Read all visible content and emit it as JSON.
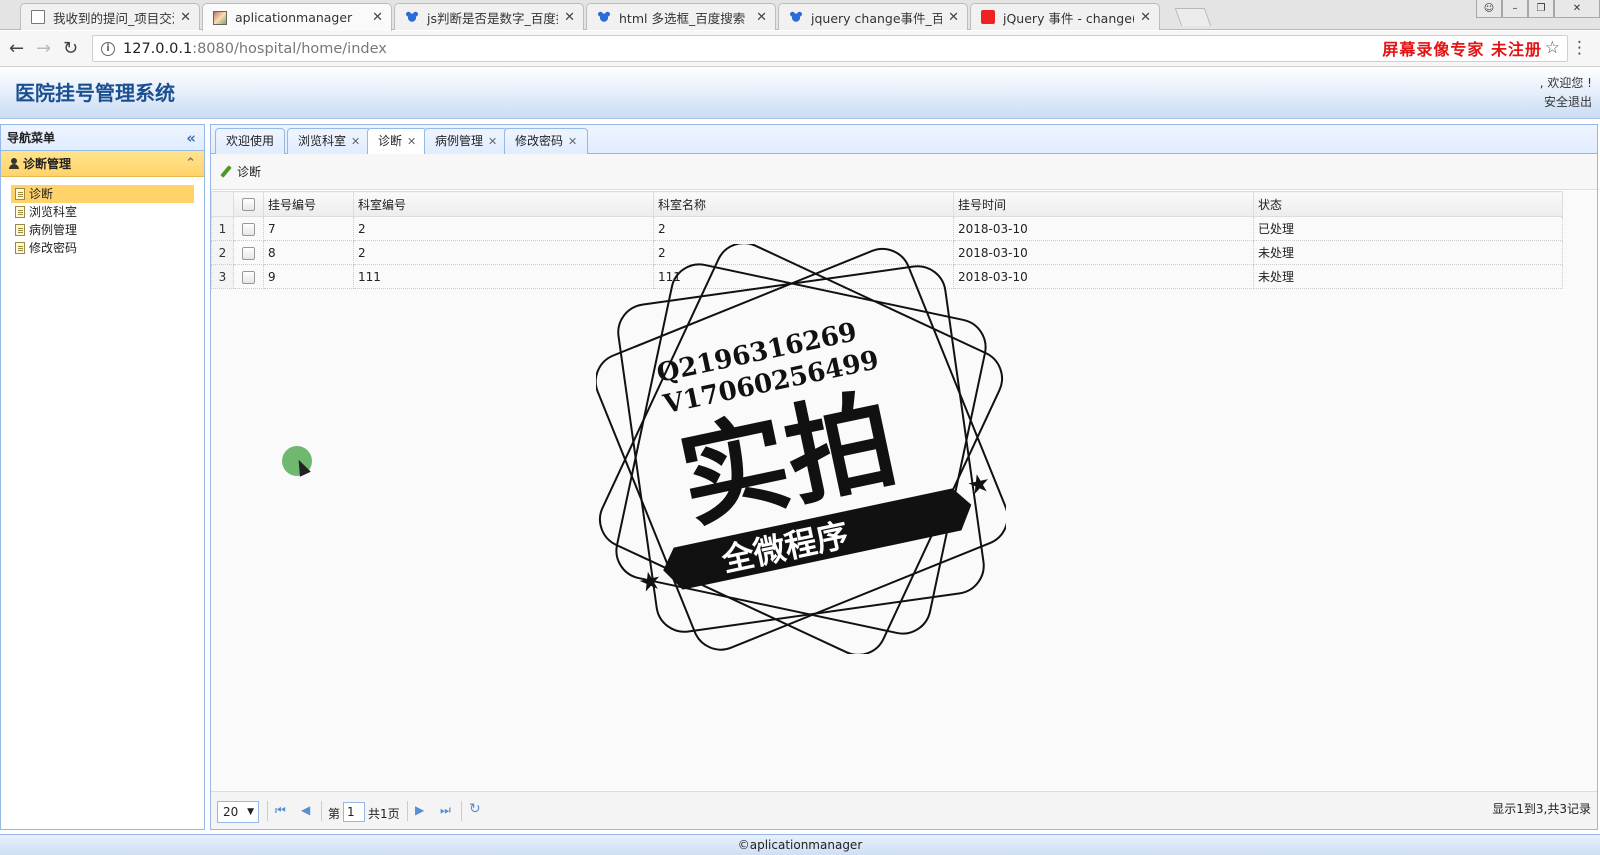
{
  "browser": {
    "tabs": [
      {
        "title": "我收到的提问_项目交流",
        "icon": "document-icon"
      },
      {
        "title": "aplicationmanager",
        "icon": "app-icon"
      },
      {
        "title": "js判断是否是数字_百度搜",
        "icon": "baidu-icon"
      },
      {
        "title": "html 多选框_百度搜索",
        "icon": "baidu-icon"
      },
      {
        "title": "jquery change事件_百度",
        "icon": "baidu-icon"
      },
      {
        "title": "jQuery 事件 - change()",
        "icon": "w3school-icon"
      }
    ],
    "url_host": "127.0.0.1",
    "url_path": ":8080/hospital/home/index",
    "recorder_watermark": "屏幕录像专家 未注册"
  },
  "header": {
    "title": "医院挂号管理系统",
    "welcome": ", 欢迎您 !",
    "logout": "安全退出"
  },
  "sidebar": {
    "title": "导航菜单",
    "group": "诊断管理",
    "items": [
      {
        "label": "诊断",
        "selected": true
      },
      {
        "label": "浏览科室",
        "selected": false
      },
      {
        "label": "病例管理",
        "selected": false
      },
      {
        "label": "修改密码",
        "selected": false
      }
    ]
  },
  "main": {
    "tabs": [
      {
        "label": "欢迎使用",
        "closable": false
      },
      {
        "label": "浏览科室",
        "closable": true
      },
      {
        "label": "诊断",
        "closable": true,
        "active": true
      },
      {
        "label": "病例管理",
        "closable": true
      },
      {
        "label": "修改密码",
        "closable": true
      }
    ],
    "toolbar_button": "诊断",
    "table": {
      "columns": [
        "挂号编号",
        "科室编号",
        "科室名称",
        "挂号时间",
        "状态"
      ],
      "rows": [
        {
          "rownum": "1",
          "cells": [
            "7",
            "2",
            "2",
            "2018-03-10",
            "已处理"
          ]
        },
        {
          "rownum": "2",
          "cells": [
            "8",
            "2",
            "2",
            "2018-03-10",
            "未处理"
          ]
        },
        {
          "rownum": "3",
          "cells": [
            "9",
            "111",
            "111",
            "2018-03-10",
            "未处理"
          ]
        }
      ]
    },
    "pager": {
      "page_size": "20",
      "page_prefix": "第",
      "page_value": "1",
      "page_total": "共1页",
      "info": "显示1到3,共3记录"
    }
  },
  "footer": {
    "text": "©aplicationmanager"
  },
  "stamp": {
    "line1": "Q2196316269",
    "line2": "V17060256499",
    "big": "实拍",
    "banner": "全微程序"
  }
}
